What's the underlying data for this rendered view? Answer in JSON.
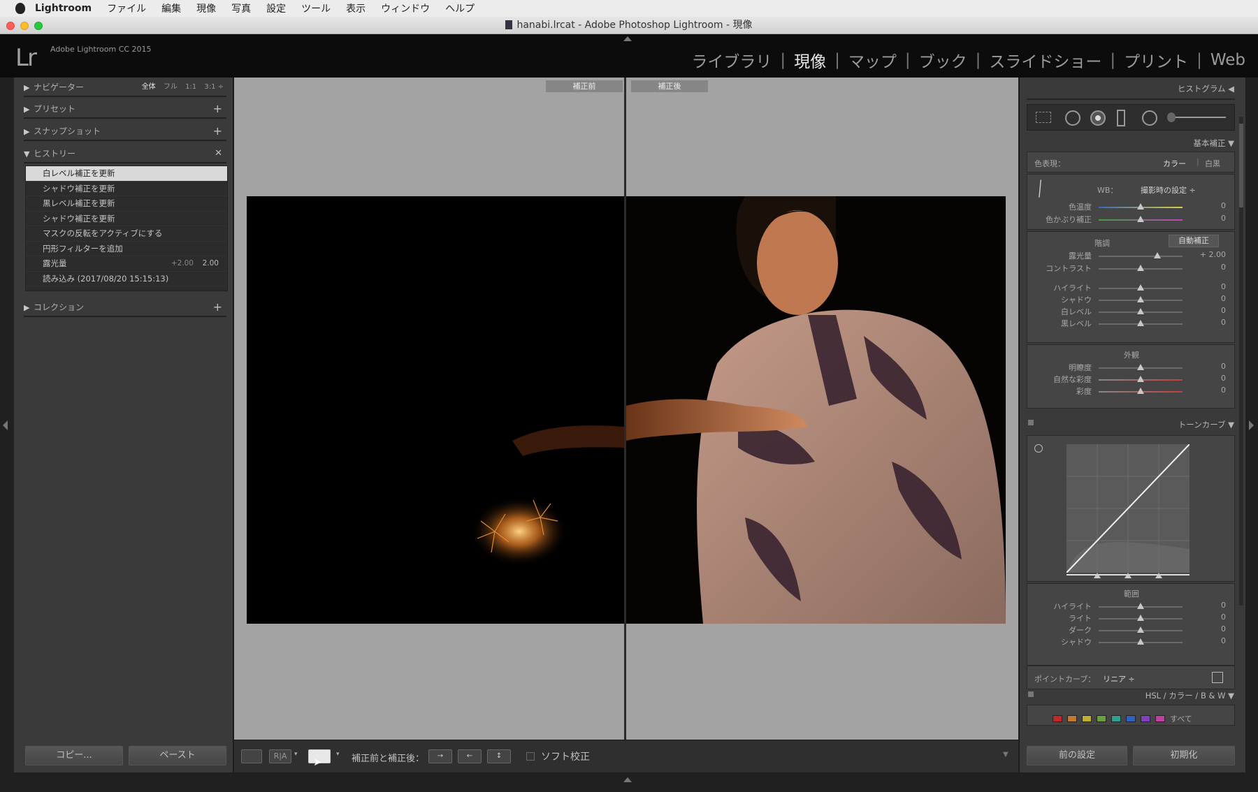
{
  "menubar": {
    "app": "Lightroom",
    "items": [
      "ファイル",
      "編集",
      "現像",
      "写真",
      "設定",
      "ツール",
      "表示",
      "ウィンドウ",
      "ヘルプ"
    ]
  },
  "window": {
    "title": "hanabi.lrcat - Adobe Photoshop Lightroom - 現像"
  },
  "identity": {
    "logo": "Lr",
    "product": "Adobe Lightroom CC 2015"
  },
  "modules": [
    "ライブラリ",
    "現像",
    "マップ",
    "ブック",
    "スライドショー",
    "プリント",
    "Web"
  ],
  "left": {
    "navigator": {
      "label": "ナビゲーター",
      "zoom": [
        "全体",
        "フル",
        "1:1",
        "3:1 ÷"
      ]
    },
    "presets": "プリセット",
    "snapshots": "スナップショット",
    "history": {
      "label": "ヒストリー",
      "items": [
        {
          "label": "白レベル補正を更新",
          "v1": "",
          "v2": ""
        },
        {
          "label": "シャドウ補正を更新",
          "v1": "",
          "v2": ""
        },
        {
          "label": "黒レベル補正を更新",
          "v1": "",
          "v2": ""
        },
        {
          "label": "シャドウ補正を更新",
          "v1": "",
          "v2": ""
        },
        {
          "label": "マスクの反転をアクティブにする",
          "v1": "",
          "v2": ""
        },
        {
          "label": "円形フィルターを追加",
          "v1": "",
          "v2": ""
        },
        {
          "label": "露光量",
          "v1": "+2.00",
          "v2": "2.00"
        },
        {
          "label": "読み込み (2017/08/20 15:15:13)",
          "v1": "",
          "v2": ""
        }
      ]
    },
    "collections": "コレクション",
    "copy_btn": "コピー...",
    "paste_btn": "ペースト"
  },
  "center": {
    "before": "補正前",
    "after": "補正後"
  },
  "toolbar": {
    "compare_label": "補正前と補正後：",
    "soft_proof": "ソフト校正",
    "ra": "R|A"
  },
  "right": {
    "histogram": "ヒストグラム ◀",
    "basic": "基本補正 ▼",
    "treatment": {
      "label": "色表現：",
      "color": "カラー",
      "bw": "白黒"
    },
    "wb": {
      "label": "WB：",
      "value": "撮影時の設定 ÷"
    },
    "wb_sliders": [
      {
        "label": "色温度",
        "value": "0",
        "pos": 0.5
      },
      {
        "label": "色かぶり補正",
        "value": "0",
        "pos": 0.5
      }
    ],
    "tone": {
      "label": "階調",
      "auto": "自動補正"
    },
    "tone_sliders": [
      {
        "label": "露光量",
        "value": "+ 2.00",
        "pos": 0.7
      },
      {
        "label": "コントラスト",
        "value": "0",
        "pos": 0.5
      },
      {
        "label": "ハイライト",
        "value": "0",
        "pos": 0.5
      },
      {
        "label": "シャドウ",
        "value": "0",
        "pos": 0.5
      },
      {
        "label": "白レベル",
        "value": "0",
        "pos": 0.5
      },
      {
        "label": "黒レベル",
        "value": "0",
        "pos": 0.5
      }
    ],
    "presence": {
      "label": "外観"
    },
    "presence_sliders": [
      {
        "label": "明瞭度",
        "value": "0",
        "pos": 0.5
      },
      {
        "label": "自然な彩度",
        "value": "0",
        "pos": 0.5
      },
      {
        "label": "彩度",
        "value": "0",
        "pos": 0.5
      }
    ],
    "tonecurve": "トーンカーブ ▼",
    "region": {
      "label": "範囲"
    },
    "region_sliders": [
      {
        "label": "ハイライト",
        "value": "0",
        "pos": 0.5
      },
      {
        "label": "ライト",
        "value": "0",
        "pos": 0.5
      },
      {
        "label": "ダーク",
        "value": "0",
        "pos": 0.5
      },
      {
        "label": "シャドウ",
        "value": "0",
        "pos": 0.5
      }
    ],
    "pointcurve": {
      "label": "ポイントカーブ：",
      "value": "リニア ÷"
    },
    "hsl": "HSL / カラー / B & W ▼",
    "hsl_all": "すべて",
    "hsl_colors": [
      "#c0282a",
      "#c07a30",
      "#c0b030",
      "#6aa040",
      "#30a090",
      "#3060c0",
      "#8040c0",
      "#c040a0"
    ],
    "prev_btn": "前の設定",
    "reset_btn": "初期化"
  }
}
